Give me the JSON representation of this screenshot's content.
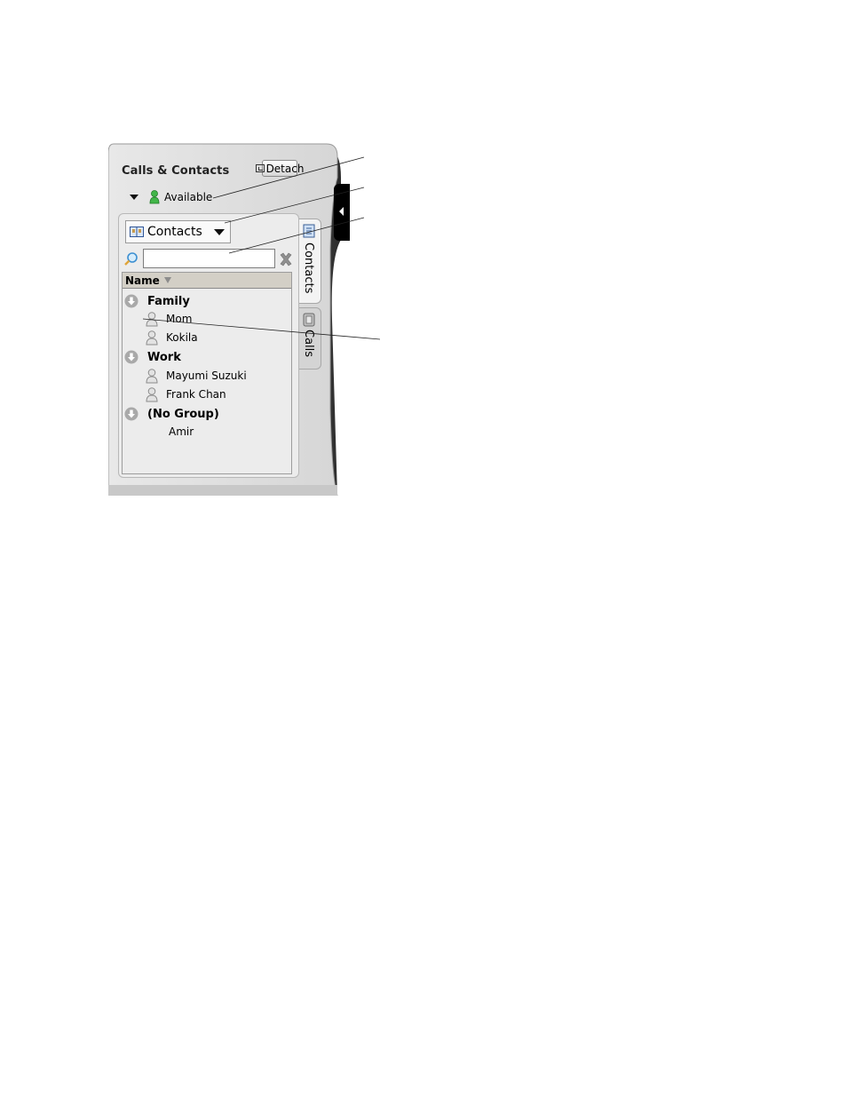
{
  "window": {
    "title": "Calls & Contacts",
    "detach_label": "Detach"
  },
  "status": {
    "label": "Available",
    "color": "#3cb043"
  },
  "contacts_dropdown": {
    "selected": "Contacts"
  },
  "search": {
    "value": "",
    "placeholder": ""
  },
  "list": {
    "column_header": "Name",
    "groups": [
      {
        "label": "Family",
        "contacts": [
          "Mom",
          "Kokila"
        ]
      },
      {
        "label": "Work",
        "contacts": [
          "Mayumi Suzuki",
          "Frank Chan"
        ]
      },
      {
        "label": "(No Group)",
        "contacts": [
          "Amir"
        ]
      }
    ]
  },
  "tabs": {
    "contacts": "Contacts",
    "calls": "Calls"
  },
  "icons": {
    "status": "green-person-icon",
    "contact": "gray-person-icon",
    "group": "collapse-arrow-icon",
    "search": "magnifier-icon",
    "clear": "x-icon",
    "detach": "detach-window-icon"
  }
}
